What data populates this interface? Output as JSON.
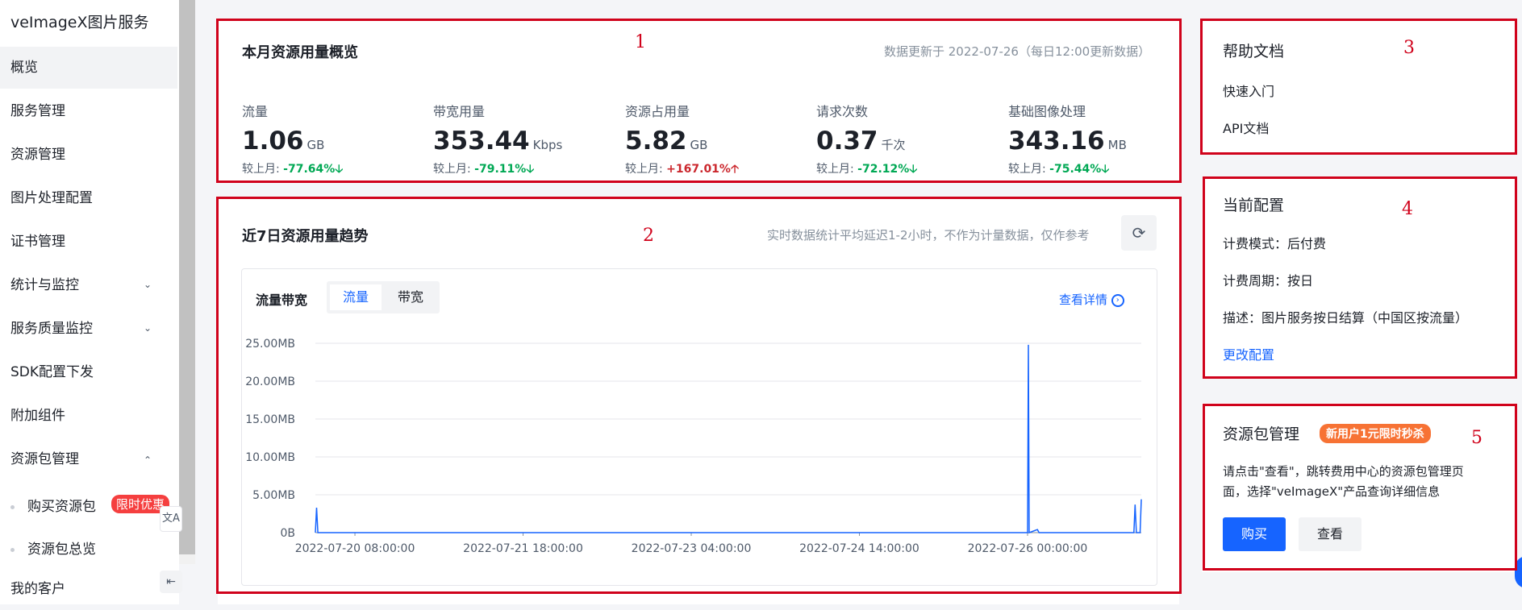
{
  "app": {
    "title": "veImageX图片服务"
  },
  "sidebar": {
    "items": [
      {
        "label": "概览",
        "active": true
      },
      {
        "label": "服务管理"
      },
      {
        "label": "资源管理"
      },
      {
        "label": "图片处理配置"
      },
      {
        "label": "证书管理"
      },
      {
        "label": "统计与监控",
        "chevron": "chevron-down"
      },
      {
        "label": "服务质量监控",
        "chevron": "chevron-down"
      },
      {
        "label": "SDK配置下发"
      },
      {
        "label": "附加组件"
      },
      {
        "label": "资源包管理",
        "chevron": "chevron-up"
      }
    ],
    "sub_items": [
      {
        "label": "购买资源包",
        "badge": "限时优惠"
      },
      {
        "label": "资源包总览"
      }
    ],
    "last_item": "我的客户",
    "translate_icon": "文A"
  },
  "overview": {
    "title": "本月资源用量概览",
    "updated": "数据更新于 2022-07-26（每日12:00更新数据）",
    "compare_label": "较上月:",
    "metrics": [
      {
        "label": "流量",
        "value": "1.06",
        "unit": "GB",
        "change": "-77.64%",
        "dir": "down"
      },
      {
        "label": "带宽用量",
        "value": "353.44",
        "unit": "Kbps",
        "change": "-79.11%",
        "dir": "down"
      },
      {
        "label": "资源占用量",
        "value": "5.82",
        "unit": "GB",
        "change": "+167.01%",
        "dir": "up"
      },
      {
        "label": "请求次数",
        "value": "0.37",
        "unit": "千次",
        "change": "-72.12%",
        "dir": "down"
      },
      {
        "label": "基础图像处理",
        "value": "343.16",
        "unit": "MB",
        "change": "-75.44%",
        "dir": "down"
      }
    ]
  },
  "trend": {
    "title": "近7日资源用量趋势",
    "note": "实时数据统计平均延迟1-2小时，不作为计量数据，仅作参考",
    "chart_title": "流量带宽",
    "tabs": [
      "流量",
      "带宽"
    ],
    "active_tab": 0,
    "details_link": "查看详情"
  },
  "chart_data": {
    "type": "line",
    "color": "#1664ff",
    "y_ticks": [
      "0B",
      "5.00MB",
      "10.00MB",
      "15.00MB",
      "20.00MB",
      "25.00MB"
    ],
    "ylim": [
      0,
      25
    ],
    "x_ticks": [
      "2022-07-20 08:00:00",
      "2022-07-21 18:00:00",
      "2022-07-23 04:00:00",
      "2022-07-24 14:00:00",
      "2022-07-26 00:00:00"
    ],
    "xlim": [
      "2022-07-20 00:00:00",
      "2022-07-26 23:00:00"
    ],
    "series": [
      {
        "points": [
          {
            "x": "2022-07-20 00:00:00",
            "y": 0
          },
          {
            "x": "2022-07-20 00:15:00",
            "y": 3.3
          },
          {
            "x": "2022-07-20 00:30:00",
            "y": 0
          },
          {
            "x": "2022-07-26 00:00:00",
            "y": 0
          },
          {
            "x": "2022-07-26 00:10:00",
            "y": 24.8
          },
          {
            "x": "2022-07-26 00:20:00",
            "y": 0
          },
          {
            "x": "2022-07-26 02:00:00",
            "y": 0.4
          },
          {
            "x": "2022-07-26 02:20:00",
            "y": 0
          },
          {
            "x": "2022-07-26 21:30:00",
            "y": 0
          },
          {
            "x": "2022-07-26 21:45:00",
            "y": 3.7
          },
          {
            "x": "2022-07-26 22:00:00",
            "y": 0
          },
          {
            "x": "2022-07-26 22:45:00",
            "y": 0
          },
          {
            "x": "2022-07-26 23:00:00",
            "y": 4.4
          }
        ]
      }
    ]
  },
  "help": {
    "title": "帮助文档",
    "links": [
      "快速入门",
      "API文档"
    ]
  },
  "config": {
    "title": "当前配置",
    "billing_mode": "计费模式：后付费",
    "billing_cycle": "计费周期：按日",
    "description": "描述：图片服务按日结算（中国区按流量）",
    "change_link": "更改配置"
  },
  "package": {
    "title": "资源包管理",
    "tag": "新用户1元限时秒杀",
    "text1": "请点击\"查看\"，跳转费用中心的资源包管理页",
    "text2": "面，选择\"veImageX\"产品查询详细信息",
    "buy": "购买",
    "view": "查看"
  },
  "annotations": [
    "1",
    "2",
    "3",
    "4",
    "5"
  ]
}
